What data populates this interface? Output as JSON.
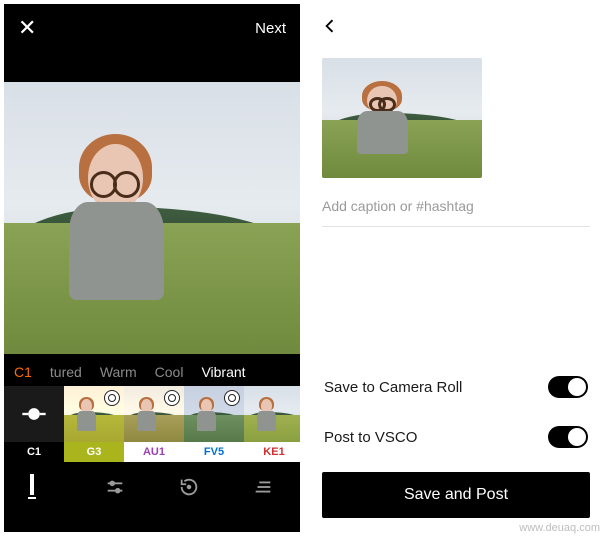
{
  "editor": {
    "close_label": "✕",
    "next_label": "Next",
    "category_tabs": {
      "c1": "C1",
      "featured_partial": "tured",
      "warm": "Warm",
      "cool": "Cool",
      "vibrant": "Vibrant"
    },
    "filters": [
      {
        "code": "C1",
        "kind": "current",
        "label_style": "label-bg-black"
      },
      {
        "code": "G3",
        "kind": "tint-yellow",
        "label_style": "label-bg-olive",
        "wheel": true
      },
      {
        "code": "AU1",
        "kind": "tint-warm",
        "label_style": "label-txt-purple",
        "wheel": true
      },
      {
        "code": "FV5",
        "kind": "tint-cool",
        "label_style": "label-txt-blue",
        "wheel": true
      },
      {
        "code": "KE1",
        "kind": "tint-vivid",
        "label_style": "label-txt-red",
        "wheel": true
      }
    ],
    "toolbar_icons": [
      "presets",
      "adjust",
      "history",
      "organize"
    ]
  },
  "save": {
    "caption_placeholder": "Add caption or #hashtag",
    "toggles": {
      "camera_roll_label": "Save to Camera Roll",
      "camera_roll_on": true,
      "vsco_label": "Post to VSCO",
      "vsco_on": true
    },
    "primary_button": "Save and Post"
  },
  "watermark": "www.deuaq.com"
}
